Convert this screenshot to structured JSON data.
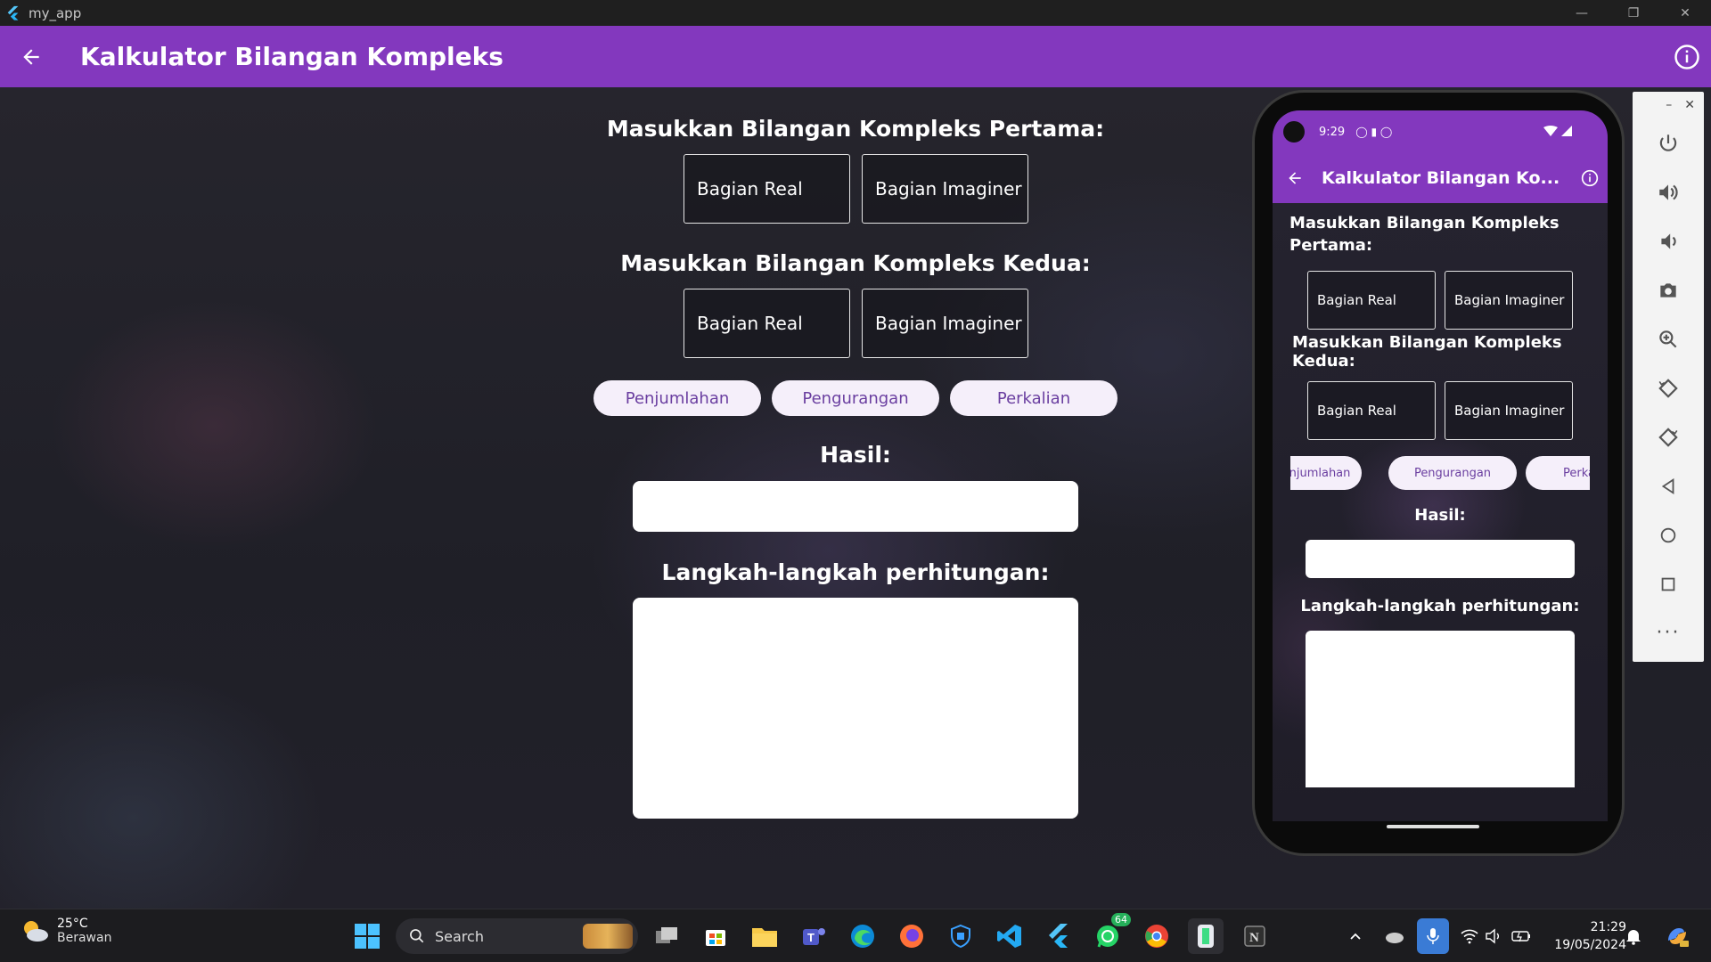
{
  "window": {
    "title": "my_app"
  },
  "appbar": {
    "title": "Kalkulator Bilangan Kompleks"
  },
  "form": {
    "first_heading": "Masukkan Bilangan Kompleks Pertama:",
    "second_heading": "Masukkan Bilangan Kompleks Kedua:",
    "real_placeholder": "Bagian Real",
    "imag_placeholder": "Bagian Imaginer",
    "ops": [
      "Penjumlahan",
      "Pengurangan",
      "Perkalian"
    ],
    "result_heading": "Hasil:",
    "steps_heading": "Langkah-langkah perhitungan:",
    "result_value": "",
    "steps_value": ""
  },
  "phone": {
    "time": "9:29",
    "title": "Kalkulator Bilangan Ko...",
    "first_heading_line1": "Masukkan Bilangan Kompleks",
    "first_heading_line2": "Pertama:",
    "second_heading": "Masukkan Bilangan Kompleks Kedua:",
    "real_placeholder": "Bagian Real",
    "imag_placeholder": "Bagian Imaginer",
    "ops": [
      "njumlahan",
      "Pengurangan",
      "Perka"
    ],
    "result_heading": "Hasil:",
    "steps_heading": "Langkah-langkah perhitungan:"
  },
  "taskbar": {
    "weather_temp": "25°C",
    "weather_cond": "Berawan",
    "search_label": "Search",
    "whatsapp_badge": "64",
    "time": "21:29",
    "date": "19/05/2024"
  },
  "colors": {
    "accent": "#8338be",
    "button_bg": "#f5effa",
    "button_text": "#6a3ea0"
  }
}
